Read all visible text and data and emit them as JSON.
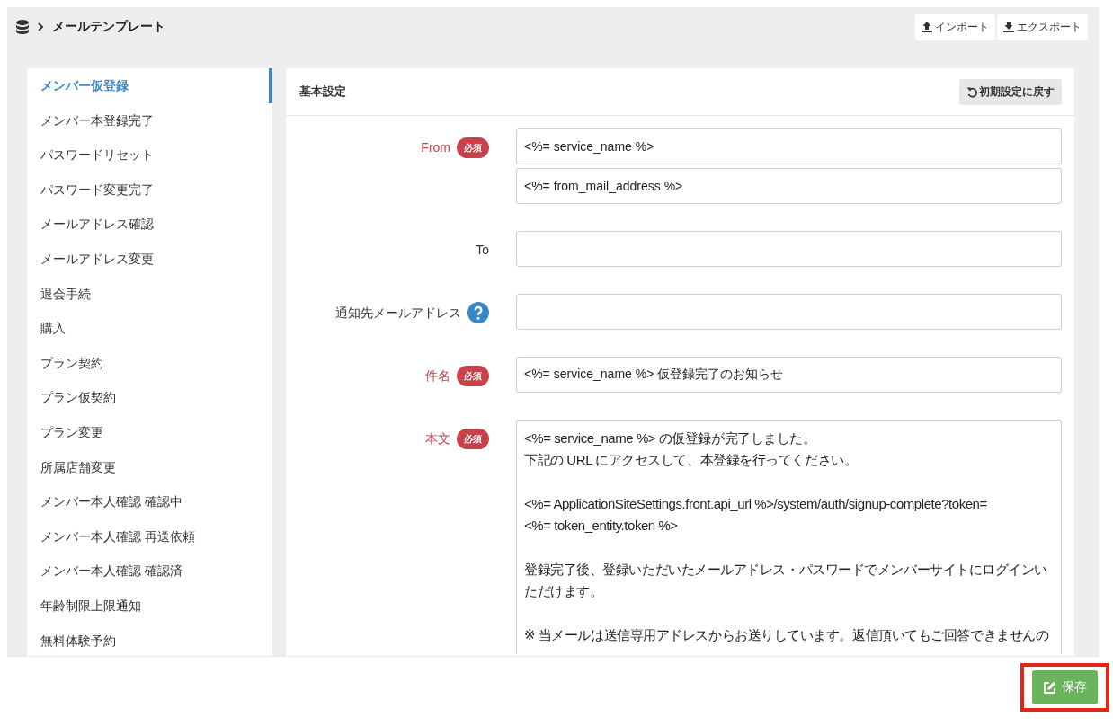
{
  "breadcrumb": {
    "title": "メールテンプレート"
  },
  "header_buttons": [
    {
      "kind": "import",
      "label": "インポート"
    },
    {
      "kind": "export",
      "label": "エクスポート"
    }
  ],
  "sidebar": {
    "items": [
      {
        "label": "メンバー仮登録",
        "selected": true
      },
      {
        "label": "メンバー本登録完了",
        "selected": false
      },
      {
        "label": "パスワードリセット",
        "selected": false
      },
      {
        "label": "パスワード変更完了",
        "selected": false
      },
      {
        "label": "メールアドレス確認",
        "selected": false
      },
      {
        "label": "メールアドレス変更",
        "selected": false
      },
      {
        "label": "退会手続",
        "selected": false
      },
      {
        "label": "購入",
        "selected": false
      },
      {
        "label": "プラン契約",
        "selected": false
      },
      {
        "label": "プラン仮契約",
        "selected": false
      },
      {
        "label": "プラン変更",
        "selected": false
      },
      {
        "label": "所属店舗変更",
        "selected": false
      },
      {
        "label": "メンバー本人確認 確認中",
        "selected": false
      },
      {
        "label": "メンバー本人確認 再送依頼",
        "selected": false
      },
      {
        "label": "メンバー本人確認 確認済",
        "selected": false
      },
      {
        "label": "年齢制限上限通知",
        "selected": false
      },
      {
        "label": "無料体験予約",
        "selected": false
      }
    ]
  },
  "card": {
    "title": "基本設定",
    "reset_button": "初期設定に戻す",
    "fields": [
      {
        "kind": "input",
        "label": "From",
        "required": true,
        "required_badge": "必須",
        "values": [
          "<%= service_name %>",
          "<%= from_mail_address %>"
        ]
      },
      {
        "kind": "input",
        "label": "To",
        "required": false
      },
      {
        "kind": "input",
        "label": "通知先メールアドレス",
        "required": false,
        "help": true
      },
      {
        "kind": "input",
        "label": "件名",
        "required": true,
        "required_badge": "必須",
        "values": [
          "<%= service_name %> 仮登録完了のお知らせ"
        ]
      },
      {
        "kind": "textarea",
        "label": "本文",
        "required": true,
        "required_badge": "必須",
        "paragraphs": [
          [
            "<%= service_name %> の仮登録が完了しました。",
            "下記の URL にアクセスして、本登録を行ってください。"
          ],
          [
            "<%= ApplicationSiteSettings.front.api_url %>/system/auth/signup-complete?token=",
            "<%= token_entity.token %>"
          ],
          [
            "登録完了後、登録いただいたメールアドレス・パスワードでメンバーサイトにログインいただけます。"
          ],
          [
            "※ 当メールは送信専用アドレスからお送りしています。返信頂いてもご回答できませんの"
          ]
        ]
      }
    ]
  },
  "save_button": {
    "label": "保存",
    "highlighted": true
  }
}
